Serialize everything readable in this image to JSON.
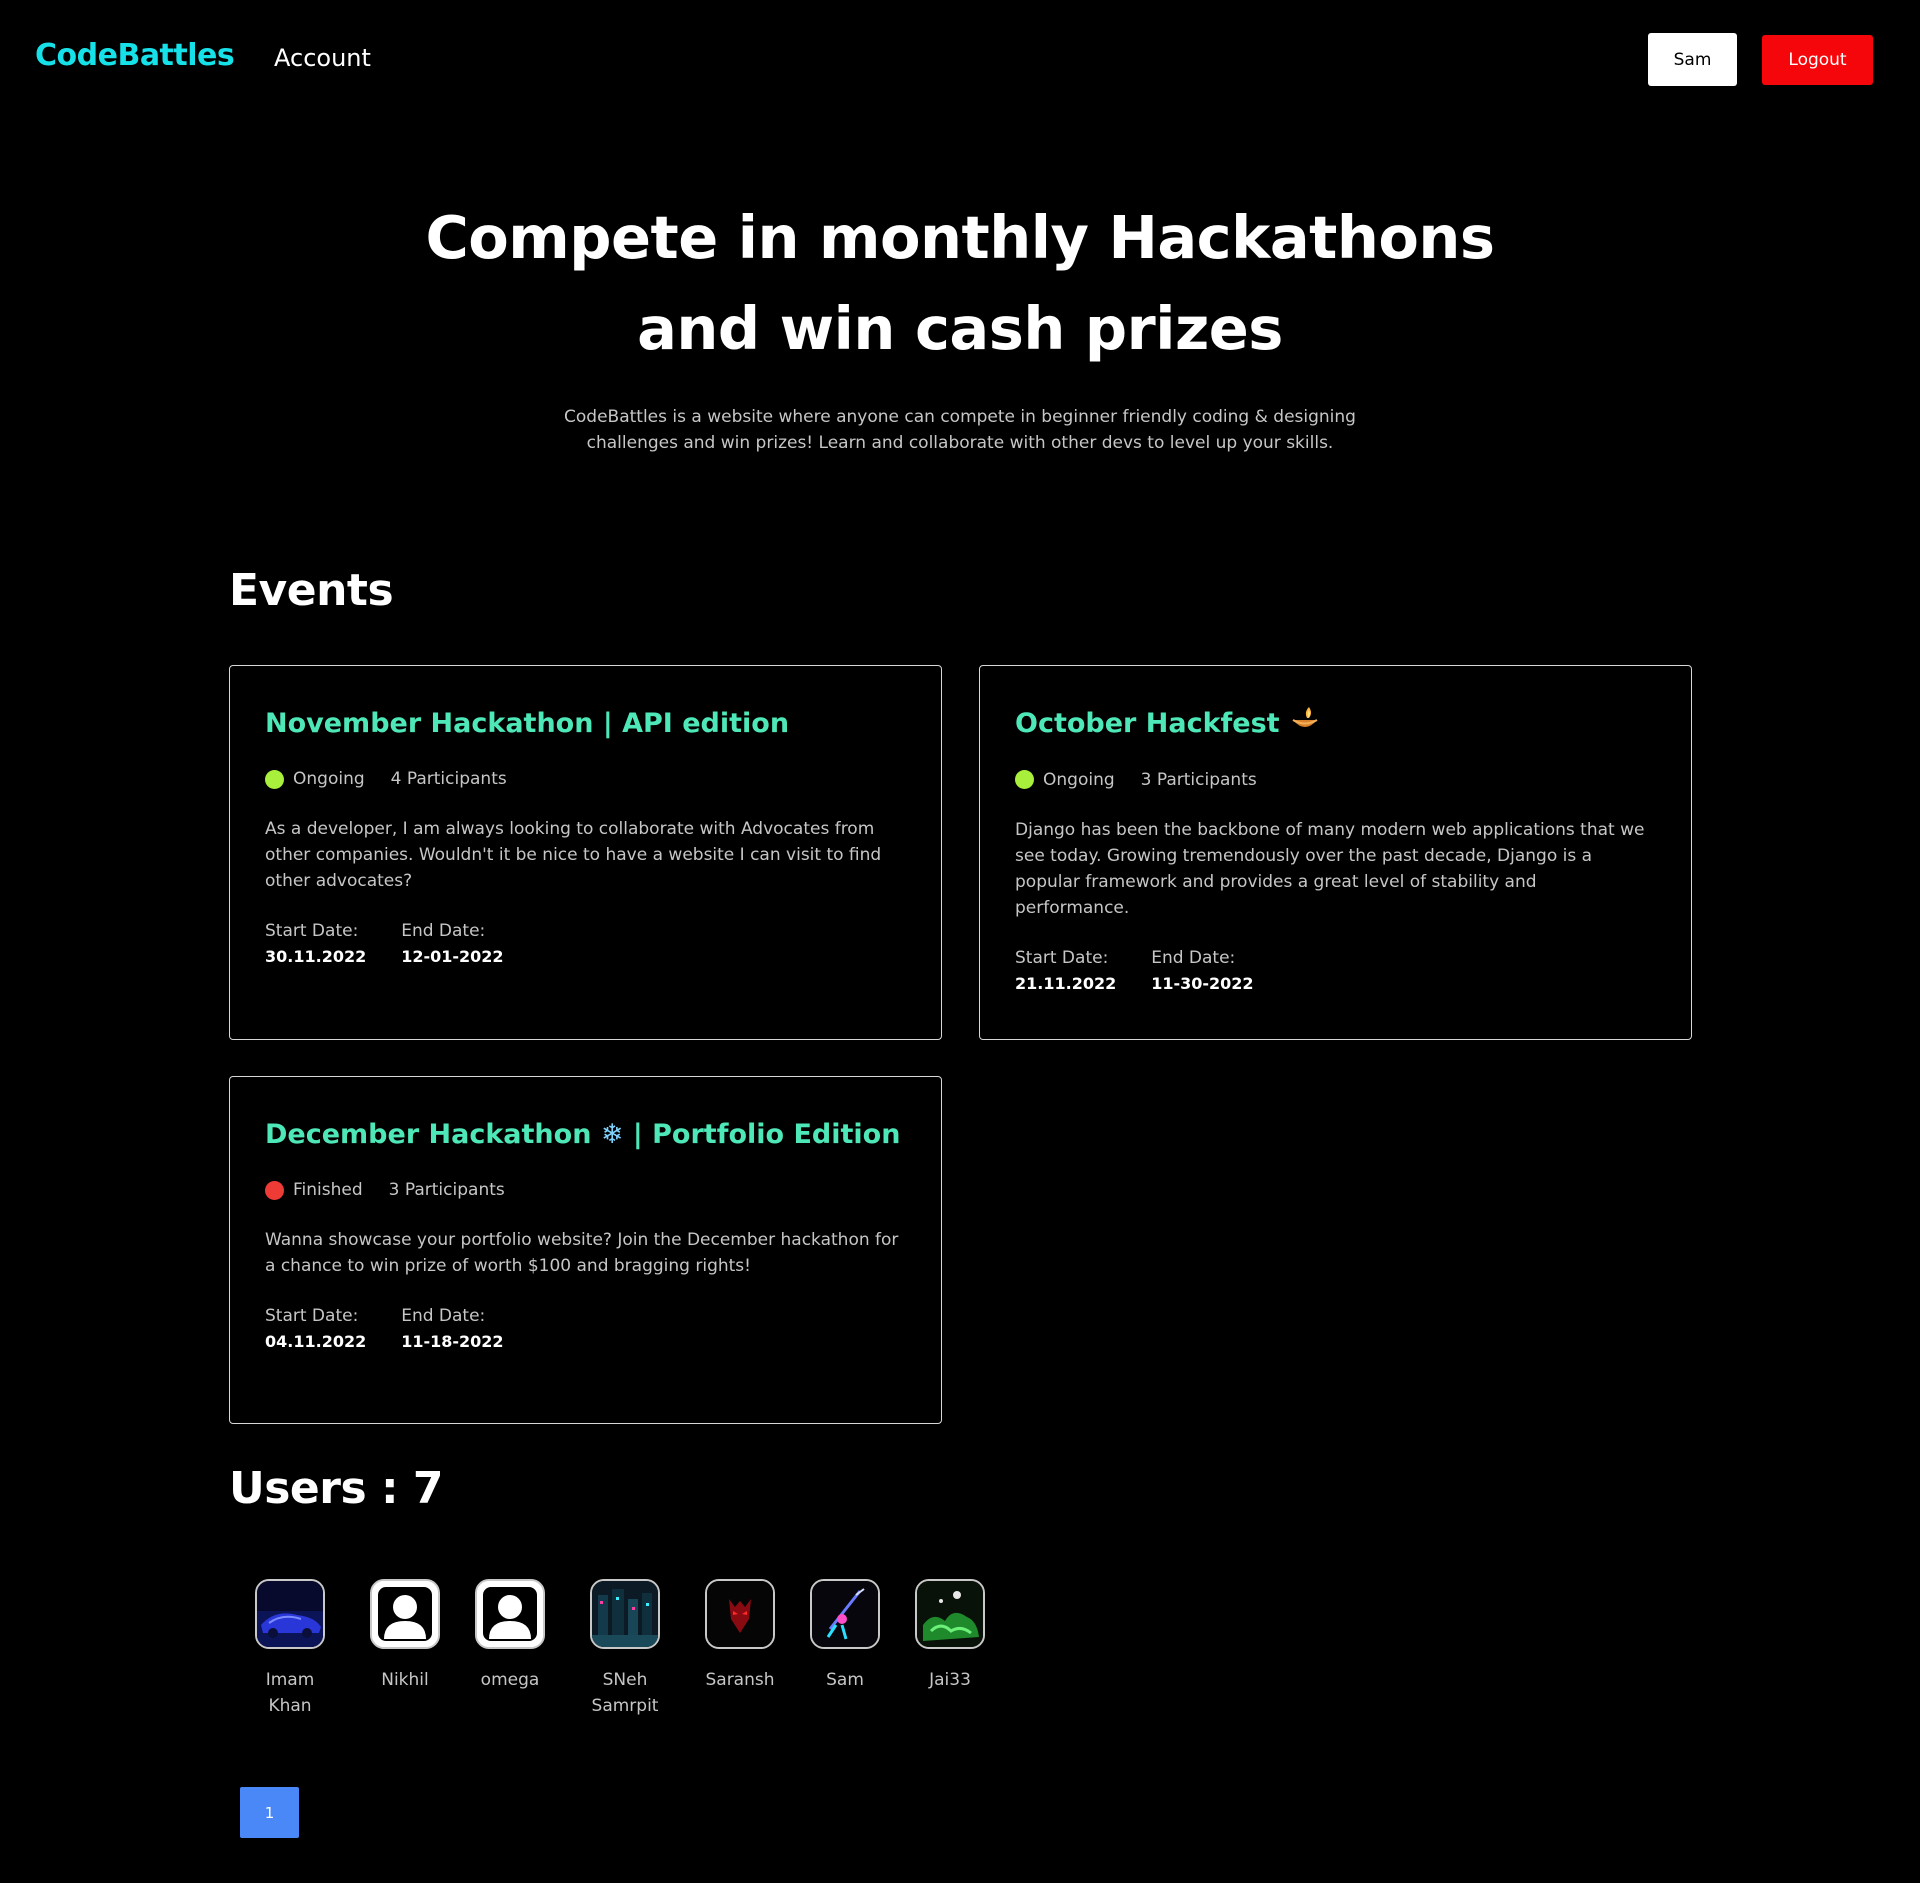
{
  "header": {
    "brand": "CodeBattles",
    "nav_account": "Account",
    "user_button": "Sam",
    "logout_button": "Logout"
  },
  "hero": {
    "title_line1": "Compete in monthly Hackathons",
    "title_line2": "and win cash prizes",
    "subtitle": "CodeBattles is a website where anyone can compete in beginner friendly coding & designing challenges and win prizes! Learn and collaborate with other devs to level up your skills."
  },
  "events": {
    "heading": "Events",
    "items": [
      {
        "title": "November Hackathon | API edition",
        "emoji": "",
        "status": "Ongoing",
        "status_color": "#a8f03c",
        "participants": "4 Participants",
        "description": "As a developer, I am always looking to collaborate with Advocates from other companies. Wouldn't it be nice to have a website I can visit to find other advocates?",
        "start_label": "Start Date:",
        "start_date": "30.11.2022",
        "end_label": "End Date:",
        "end_date": "12-01-2022"
      },
      {
        "title": "October Hackfest",
        "emoji": "oil-lamp",
        "status": "Ongoing",
        "status_color": "#a8f03c",
        "participants": "3 Participants",
        "description": "Django has been the backbone of many modern web applications that we see today. Growing tremendously over the past decade, Django is a popular framework and provides a great level of stability and performance.",
        "start_label": "Start Date:",
        "start_date": "21.11.2022",
        "end_label": "End Date:",
        "end_date": "11-30-2022"
      },
      {
        "title_part1": "December Hackathon",
        "title_emoji": "❄",
        "title_part2": "| Portfolio Edition",
        "status": "Finished",
        "status_color": "#ef3b36",
        "participants": "3 Participants",
        "description": "Wanna showcase your portfolio website? Join the December hackathon for a chance to win prize of worth $100 and bragging rights!",
        "start_label": "Start Date:",
        "start_date": "04.11.2022",
        "end_label": "End Date:",
        "end_date": "11-18-2022"
      }
    ]
  },
  "users": {
    "heading": "Users : 7",
    "items": [
      {
        "name_line1": "Imam",
        "name_line2": "Khan",
        "avatar": "blue-car-photo"
      },
      {
        "name_line1": "Nikhil",
        "name_line2": "",
        "avatar": "default-person-icon"
      },
      {
        "name_line1": "omega",
        "name_line2": "",
        "avatar": "default-person-icon"
      },
      {
        "name_line1": "SNeh",
        "name_line2": "Samrpit",
        "avatar": "cyberpunk-city-photo"
      },
      {
        "name_line1": "Saransh",
        "name_line2": "",
        "avatar": "red-mask-photo"
      },
      {
        "name_line1": "Sam",
        "name_line2": "",
        "avatar": "anime-sword-photo"
      },
      {
        "name_line1": "Jai33",
        "name_line2": "",
        "avatar": "green-splash-photo"
      }
    ]
  },
  "pagination": {
    "current_page": "1"
  },
  "colors": {
    "brand": "#16e0e8",
    "card_title": "#4ee8b8",
    "logout": "#f5060a",
    "page_button": "#4b88f7"
  }
}
